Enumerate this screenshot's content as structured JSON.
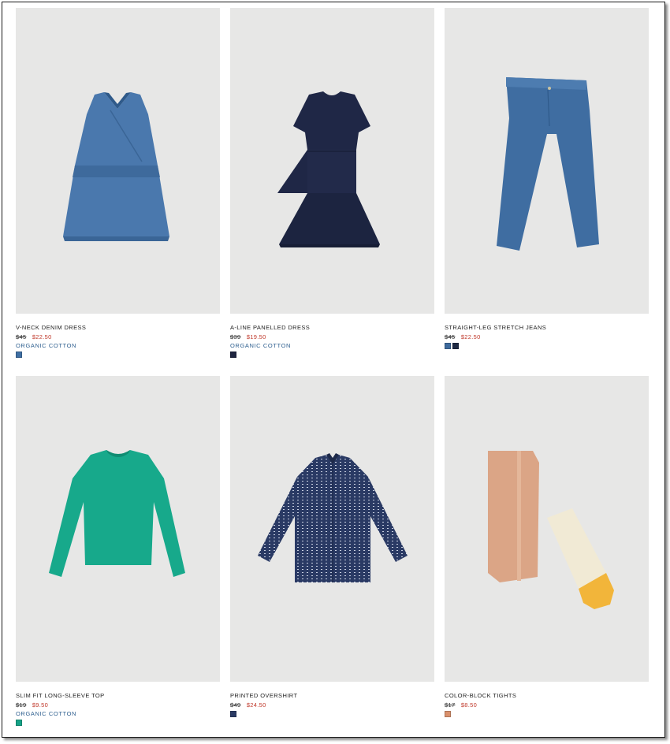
{
  "products": [
    {
      "name": "V-NECK DENIM DRESS",
      "old_price": "$45",
      "new_price": "$22.50",
      "tag": "ORGANIC COTTON",
      "swatches": [
        "#3f6fa3"
      ]
    },
    {
      "name": "A-LINE PANELLED DRESS",
      "old_price": "$39",
      "new_price": "$19.50",
      "tag": "ORGANIC COTTON",
      "swatches": [
        "#1f2540"
      ]
    },
    {
      "name": "STRAIGHT-LEG STRETCH JEANS",
      "old_price": "$45",
      "new_price": "$22.50",
      "tag": "",
      "swatches": [
        "#3e6a9c",
        "#1f2a44"
      ]
    },
    {
      "name": "SLIM FIT LONG-SLEEVE TOP",
      "old_price": "$19",
      "new_price": "$9.50",
      "tag": "ORGANIC COTTON",
      "swatches": [
        "#15a286"
      ]
    },
    {
      "name": "PRINTED OVERSHIRT",
      "old_price": "$49",
      "new_price": "$24.50",
      "tag": "",
      "swatches": [
        "#2a3a64"
      ]
    },
    {
      "name": "COLOR-BLOCK TIGHTS",
      "old_price": "$17",
      "new_price": "$8.50",
      "tag": "",
      "swatches": [
        "#d9906c"
      ]
    }
  ]
}
